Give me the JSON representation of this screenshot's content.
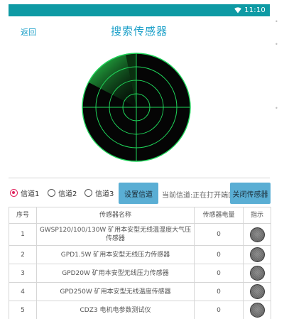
{
  "status_bar": {
    "time": "11:10",
    "bg_color": "#0e9aa4",
    "wifi_icon": "wifi-icon"
  },
  "header": {
    "back_label": "返回",
    "title": "搜索传感器",
    "accent_color": "#1a9fc8"
  },
  "radar": {
    "icon": "radar-scan-icon",
    "sweep_color": "#22c55e"
  },
  "channels": {
    "options": [
      {
        "label": "信道1",
        "selected": true
      },
      {
        "label": "信道2",
        "selected": false
      },
      {
        "label": "信道3",
        "selected": false
      }
    ],
    "set_button": "设置信道",
    "current_channel_label": "当前信道:",
    "current_channel_value": "正在打开端口",
    "close_button": "关闭传感器"
  },
  "table": {
    "headers": [
      "序号",
      "传感器名称",
      "传感器电量",
      "指示"
    ],
    "rows": [
      {
        "index": "1",
        "name": "GWSP120/100/130W 矿用本安型无线温湿度大气压传感器",
        "battery": "0"
      },
      {
        "index": "2",
        "name": "GPD1.5W 矿用本安型无线压力传感器",
        "battery": "0"
      },
      {
        "index": "3",
        "name": "GPD20W 矿用本安型无线压力传感器",
        "battery": "0"
      },
      {
        "index": "4",
        "name": "GPD250W 矿用本安型无线温度传感器",
        "battery": "0"
      },
      {
        "index": "5",
        "name": "CDZ3 电机电参数测试仪",
        "battery": "0"
      }
    ]
  }
}
